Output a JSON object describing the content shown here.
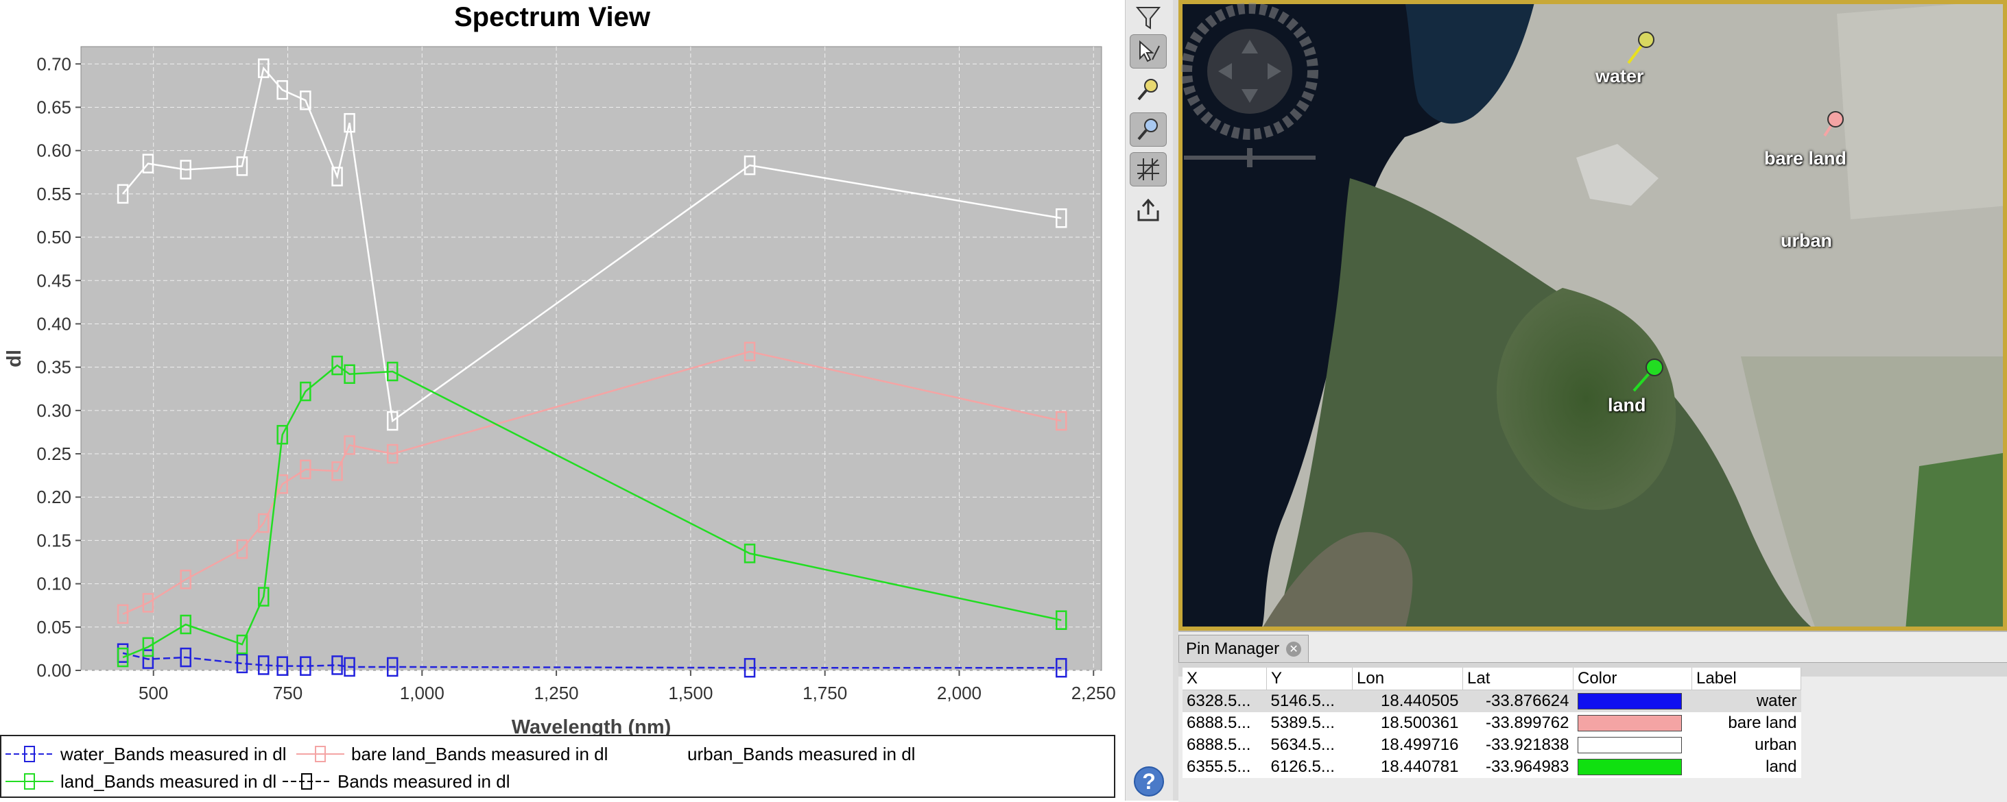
{
  "chart_data": {
    "type": "line",
    "title": "Spectrum View",
    "xlabel": "Wavelength (nm)",
    "ylabel": "dl",
    "xlim": [
      365,
      2265
    ],
    "ylim": [
      0,
      0.72
    ],
    "x_ticks": [
      500,
      750,
      1000,
      1250,
      1500,
      1750,
      2000,
      2250
    ],
    "x_tick_labels": [
      "500",
      "750",
      "1,000",
      "1,250",
      "1,500",
      "1,750",
      "2,000",
      "2,250"
    ],
    "y_ticks": [
      0,
      0.05,
      0.1,
      0.15,
      0.2,
      0.25,
      0.3,
      0.35,
      0.4,
      0.45,
      0.5,
      0.55,
      0.6,
      0.65,
      0.7
    ],
    "y_tick_labels": [
      "0.00",
      "0.05",
      "0.10",
      "0.15",
      "0.20",
      "0.25",
      "0.30",
      "0.35",
      "0.40",
      "0.45",
      "0.50",
      "0.55",
      "0.60",
      "0.65",
      "0.70"
    ],
    "grid": true,
    "legend_position": "bottom",
    "x": [
      443,
      490,
      560,
      665,
      705,
      740,
      783,
      842,
      865,
      945,
      1610,
      2190
    ],
    "series": [
      {
        "name": "water_Bands measured in dl",
        "color": "#2222dd",
        "values": [
          0.02,
          0.013,
          0.015,
          0.008,
          0.006,
          0.005,
          0.005,
          0.006,
          0.004,
          0.004,
          0.003,
          0.003
        ]
      },
      {
        "name": "bare land_Bands measured in dl",
        "color": "#f4a4a4",
        "values": [
          0.065,
          0.078,
          0.105,
          0.14,
          0.17,
          0.215,
          0.232,
          0.23,
          0.26,
          0.25,
          0.368,
          0.288
        ]
      },
      {
        "name": "urban_Bands measured in dl",
        "color": "#ffffff",
        "values": [
          0.55,
          0.585,
          0.578,
          0.582,
          0.695,
          0.67,
          0.658,
          0.57,
          0.632,
          0.288,
          0.583,
          0.522
        ]
      },
      {
        "name": "land_Bands measured in dl",
        "color": "#22dd22",
        "values": [
          0.015,
          0.027,
          0.053,
          0.03,
          0.085,
          0.272,
          0.322,
          0.352,
          0.342,
          0.345,
          0.135,
          0.058
        ]
      },
      {
        "name": "Bands measured in dl",
        "color": "#000000",
        "values": []
      }
    ]
  },
  "map": {
    "labels": [
      "water",
      "bare land",
      "urban",
      "land"
    ]
  },
  "pin_manager": {
    "tab_title": "Pin Manager",
    "close_icon": "close-icon",
    "columns": [
      "X",
      "Y",
      "Lon",
      "Lat",
      "Color",
      "Label"
    ],
    "rows": [
      {
        "x": "6328.5...",
        "y": "5146.5...",
        "lon": "18.440505",
        "lat": "-33.876624",
        "color": "#1010f0",
        "label": "water"
      },
      {
        "x": "6888.5...",
        "y": "5389.5...",
        "lon": "18.500361",
        "lat": "-33.899762",
        "color": "#f4a4a4",
        "label": "bare land"
      },
      {
        "x": "6888.5...",
        "y": "5634.5...",
        "lon": "18.499716",
        "lat": "-33.921838",
        "color": "#ffffff",
        "label": "urban"
      },
      {
        "x": "6355.5...",
        "y": "6126.5...",
        "lon": "18.440781",
        "lat": "-33.964983",
        "color": "#10e010",
        "label": "land"
      }
    ]
  },
  "toolbar": {
    "icons": [
      "filter-icon",
      "select-tool-icon",
      "zoom-pin-icon",
      "zoom-all-icon",
      "grid-icon",
      "export-icon"
    ],
    "help_label": "?"
  },
  "colors": {
    "plot_background": "#c0c0c0",
    "water": "#2222dd",
    "bare_land": "#f4a4a4",
    "urban": "#ffffff",
    "land": "#22dd22"
  }
}
